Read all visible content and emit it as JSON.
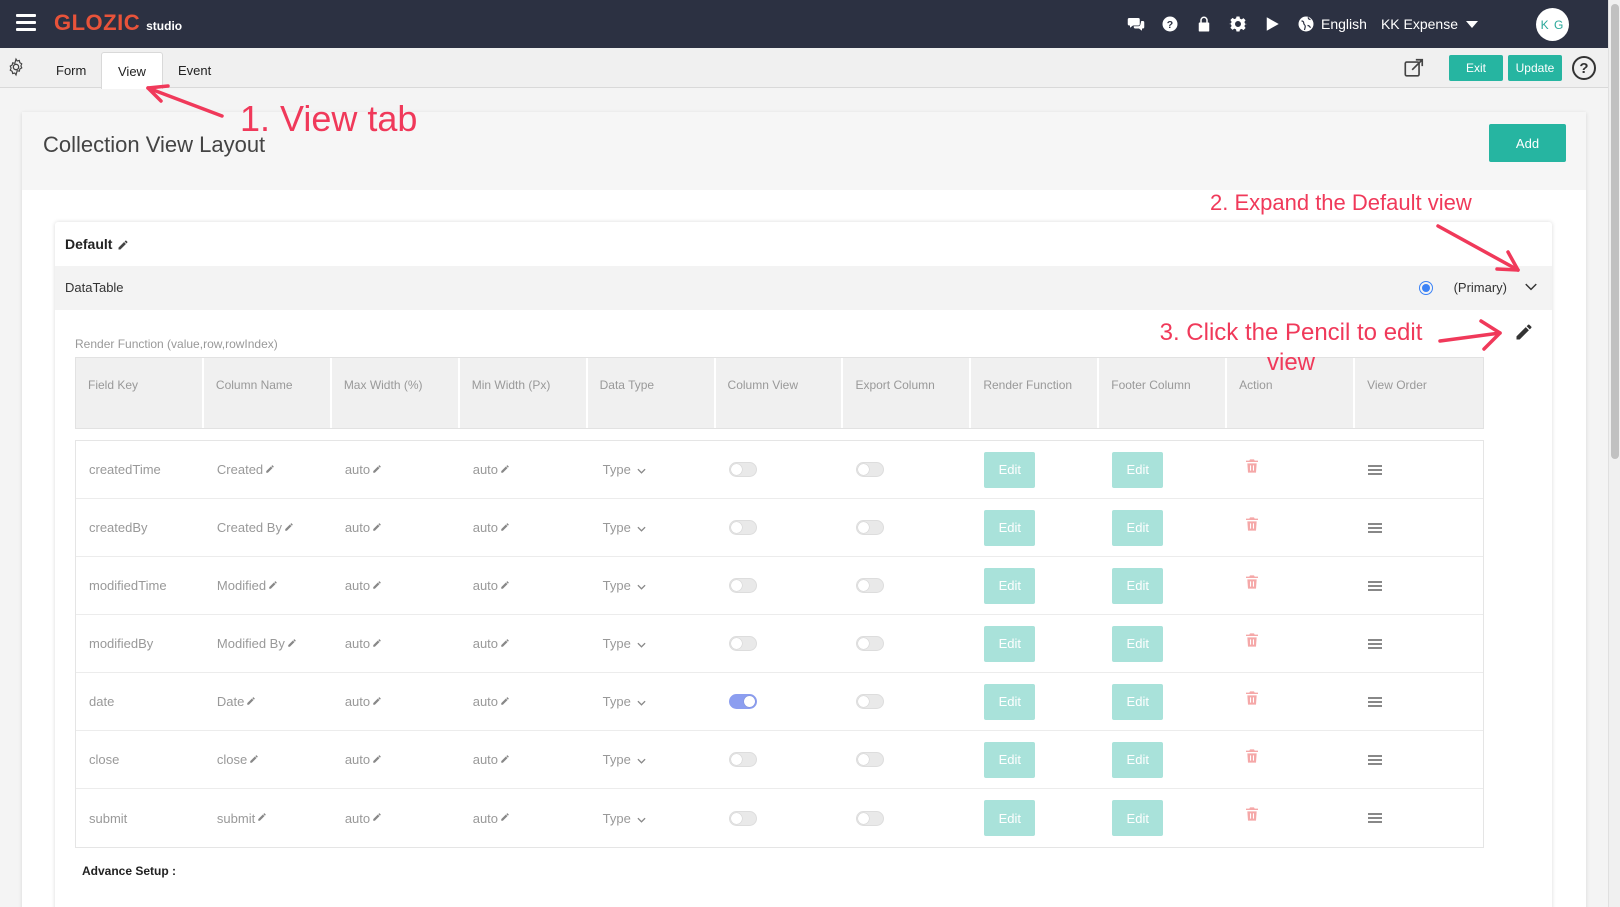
{
  "app": {
    "brand": "GLOZIC",
    "brand_sub": "studio",
    "language": "English",
    "app_name": "KK Expense",
    "avatar_initials": "K G"
  },
  "tabs": [
    {
      "label": "Form",
      "active": false
    },
    {
      "label": "View",
      "active": true
    },
    {
      "label": "Event",
      "active": false
    }
  ],
  "toolbar": {
    "exit_label": "Exit",
    "update_label": "Update"
  },
  "page": {
    "title": "Collection View Layout",
    "add_label": "Add"
  },
  "view": {
    "name": "Default",
    "component": "DataTable",
    "primary_label": "(Primary)",
    "render_fn_label": "Render Function (value,row,rowIndex)",
    "advance_label": "Advance Setup :"
  },
  "columns": [
    "Field Key",
    "Column Name",
    "Max Width (%)",
    "Min Width (Px)",
    "Data Type",
    "Column View",
    "Export Column",
    "Render Function",
    "Footer Column",
    "Action",
    "View Order"
  ],
  "rows": [
    {
      "field_key": "createdTime",
      "column_name": "Created",
      "max_width": "auto",
      "min_width": "auto",
      "data_type": "Type",
      "column_view": false,
      "export_column": false,
      "render_label": "Edit",
      "footer_label": "Edit"
    },
    {
      "field_key": "createdBy",
      "column_name": "Created By",
      "max_width": "auto",
      "min_width": "auto",
      "data_type": "Type",
      "column_view": false,
      "export_column": false,
      "render_label": "Edit",
      "footer_label": "Edit"
    },
    {
      "field_key": "modifiedTime",
      "column_name": "Modified",
      "max_width": "auto",
      "min_width": "auto",
      "data_type": "Type",
      "column_view": false,
      "export_column": false,
      "render_label": "Edit",
      "footer_label": "Edit"
    },
    {
      "field_key": "modifiedBy",
      "column_name": "Modified By",
      "max_width": "auto",
      "min_width": "auto",
      "data_type": "Type",
      "column_view": false,
      "export_column": false,
      "render_label": "Edit",
      "footer_label": "Edit"
    },
    {
      "field_key": "date",
      "column_name": "Date",
      "max_width": "auto",
      "min_width": "auto",
      "data_type": "Type",
      "column_view": true,
      "export_column": false,
      "render_label": "Edit",
      "footer_label": "Edit"
    },
    {
      "field_key": "close",
      "column_name": "close",
      "max_width": "auto",
      "min_width": "auto",
      "data_type": "Type",
      "column_view": false,
      "export_column": false,
      "render_label": "Edit",
      "footer_label": "Edit"
    },
    {
      "field_key": "submit",
      "column_name": "submit",
      "max_width": "auto",
      "min_width": "auto",
      "data_type": "Type",
      "column_view": false,
      "export_column": false,
      "render_label": "Edit",
      "footer_label": "Edit"
    }
  ],
  "annotations": {
    "step1": "1. View tab",
    "step2": "2. Expand the Default view",
    "step3_line1": "3. Click the Pencil to edit",
    "step3_line2": "view"
  },
  "colors": {
    "topbar": "#2c3142",
    "accent": "#26b5a1",
    "annotation": "#f0395a",
    "brand": "#e8533a"
  }
}
